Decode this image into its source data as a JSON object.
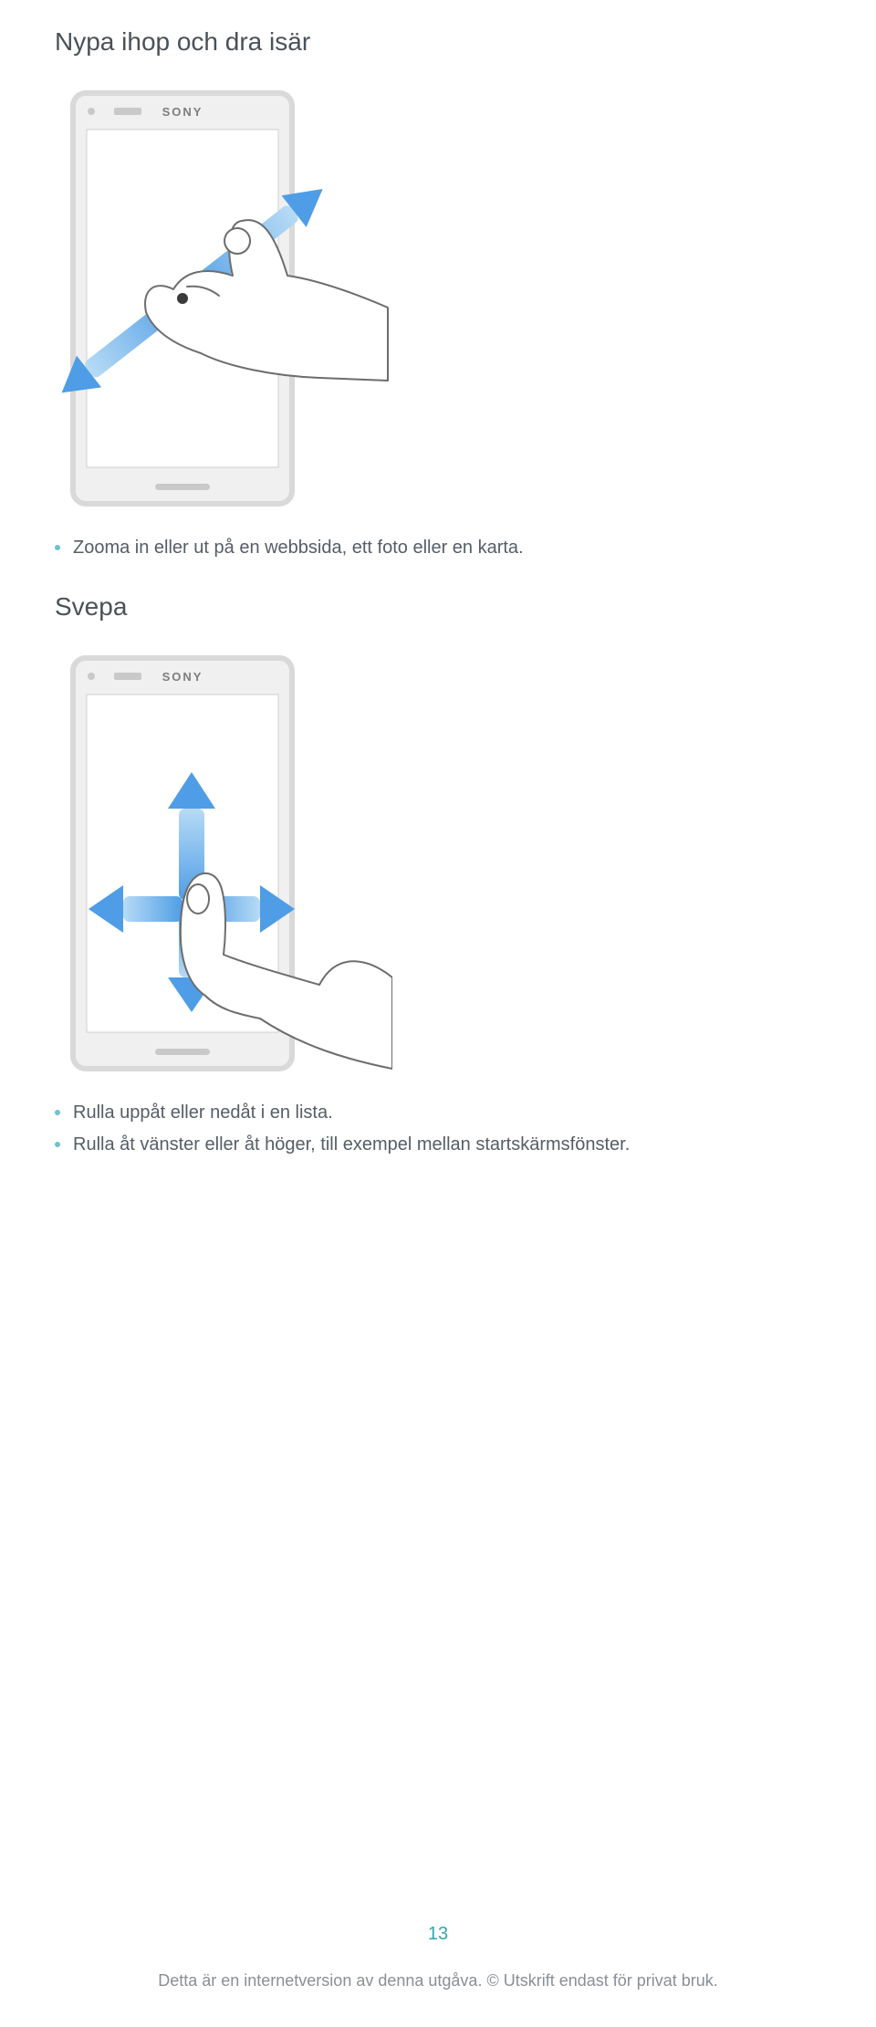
{
  "heading_pinch": "Nypa ihop och dra isär",
  "bullets_pinch": [
    "Zooma in eller ut på en webbsida, ett foto eller en karta."
  ],
  "heading_swipe": "Svepa",
  "bullets_swipe": [
    "Rulla uppåt eller nedåt i en lista.",
    "Rulla åt vänster eller åt höger, till exempel mellan startskärmsfönster."
  ],
  "page_number": "13",
  "footer": "Detta är en internetversion av denna utgåva. © Utskrift endast för privat bruk."
}
